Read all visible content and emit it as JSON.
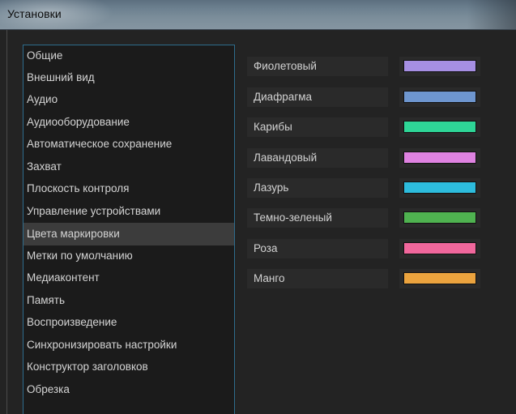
{
  "window": {
    "title": "Установки"
  },
  "categories": {
    "items": [
      {
        "label": "Общие"
      },
      {
        "label": "Внешний вид"
      },
      {
        "label": "Аудио"
      },
      {
        "label": "Аудиооборудование"
      },
      {
        "label": "Автоматическое сохранение"
      },
      {
        "label": "Захват"
      },
      {
        "label": "Плоскость контроля"
      },
      {
        "label": "Управление устройствами"
      },
      {
        "label": "Цвета маркировки"
      },
      {
        "label": "Метки по умолчанию"
      },
      {
        "label": "Медиаконтент"
      },
      {
        "label": "Память"
      },
      {
        "label": "Воспроизведение"
      },
      {
        "label": "Синхронизировать настройки"
      },
      {
        "label": "Конструктор заголовков"
      },
      {
        "label": "Обрезка"
      }
    ],
    "selected": "Цвета маркировки"
  },
  "label_colors": {
    "items": [
      {
        "label": "Фиолетовый",
        "color": "#a68fe3"
      },
      {
        "label": "Диафрагма",
        "color": "#6e96cf"
      },
      {
        "label": "Карибы",
        "color": "#2ed697"
      },
      {
        "label": "Лавандовый",
        "color": "#df82e1"
      },
      {
        "label": "Лазурь",
        "color": "#2dbcdd"
      },
      {
        "label": "Темно-зеленый",
        "color": "#4fb250"
      },
      {
        "label": "Роза",
        "color": "#f1679c"
      },
      {
        "label": "Манго",
        "color": "#eba33e"
      }
    ]
  }
}
